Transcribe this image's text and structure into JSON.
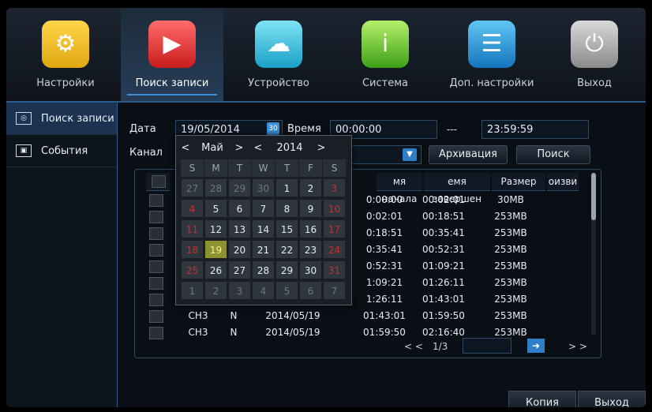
{
  "menu": [
    {
      "label": "Настройки",
      "icon": "settings-gear-icon"
    },
    {
      "label": "Поиск записи",
      "icon": "video-search-icon"
    },
    {
      "label": "Устройство",
      "icon": "hdd-cloud-icon"
    },
    {
      "label": "Система",
      "icon": "system-info-icon"
    },
    {
      "label": "Доп. настройки",
      "icon": "advanced-settings-icon"
    },
    {
      "label": "Выход",
      "icon": "power-icon"
    }
  ],
  "sidebar": [
    {
      "label": "Поиск записи",
      "icon": "film-reel-icon"
    },
    {
      "label": "События",
      "icon": "film-frame-icon"
    }
  ],
  "form": {
    "date_label": "Дата",
    "date_value": "19/05/2014",
    "time_label": "Время",
    "time_start": "00:00:00",
    "time_sep": "---",
    "time_end": "23:59:59",
    "channel_label": "Канал",
    "archive_button": "Архивация",
    "search_button": "Поиск"
  },
  "calendar": {
    "month": "Май",
    "year": "2014",
    "prev": "<",
    "next": ">",
    "dow": [
      "S",
      "M",
      "T",
      "W",
      "T",
      "F",
      "S"
    ],
    "weeks": [
      [
        "27",
        "28",
        "29",
        "30",
        "1",
        "2",
        "3"
      ],
      [
        "4",
        "5",
        "6",
        "7",
        "8",
        "9",
        "10"
      ],
      [
        "11",
        "12",
        "13",
        "14",
        "15",
        "16",
        "17"
      ],
      [
        "18",
        "19",
        "20",
        "21",
        "22",
        "23",
        "24"
      ],
      [
        "25",
        "26",
        "27",
        "28",
        "29",
        "30",
        "31"
      ],
      [
        "1",
        "2",
        "3",
        "4",
        "5",
        "6",
        "7"
      ]
    ],
    "selected": "19"
  },
  "table": {
    "headers": [
      "мя начала",
      "емя завершен",
      "Размер",
      "оизви"
    ],
    "rows": [
      [
        "",
        "",
        "",
        "0:00:00",
        "00:02:01",
        "30MB"
      ],
      [
        "",
        "",
        "",
        "0:02:01",
        "00:18:51",
        "253MB"
      ],
      [
        "",
        "",
        "",
        "0:18:51",
        "00:35:41",
        "253MB"
      ],
      [
        "",
        "",
        "",
        "0:35:41",
        "00:52:31",
        "253MB"
      ],
      [
        "",
        "",
        "",
        "0:52:31",
        "01:09:21",
        "253MB"
      ],
      [
        "",
        "",
        "",
        "1:09:21",
        "01:26:11",
        "253MB"
      ],
      [
        "",
        "",
        "",
        "1:26:11",
        "01:43:01",
        "253MB"
      ],
      [
        "CH3",
        "N",
        "2014/05/19",
        "01:43:01",
        "01:59:50",
        "253MB"
      ],
      [
        "CH3",
        "N",
        "2014/05/19",
        "01:59:50",
        "02:16:40",
        "253MB"
      ]
    ]
  },
  "pager": {
    "prev": "< <",
    "page": "1/3",
    "next": "> >"
  },
  "footer": {
    "copy": "Копия",
    "exit": "Выход"
  }
}
